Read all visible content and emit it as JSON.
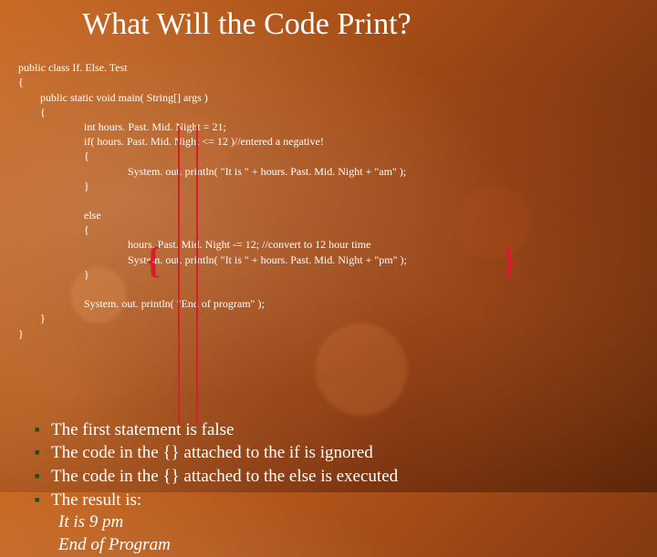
{
  "title": "What Will the Code Print?",
  "code": {
    "l1": "public class If. Else. Test",
    "l2": "{",
    "l3": "        public static void main( String[] args )",
    "l4": "        {",
    "l5": "                        int hours. Past. Mid. Night = 21;",
    "l6": "                        if( hours. Past. Mid. Night <= 12 )//entered a negative!",
    "l7": "                        {",
    "l8": "                                        System. out. println( \"It is \" + hours. Past. Mid. Night + \"am\" );",
    "l9": "                        }",
    "l10": "",
    "l11": "                        else",
    "l12": "                        {",
    "l13": "                                        hours. Past. Mid. Night -= 12; //convert to 12 hour time",
    "l14": "                                        System. out. println( \"It is \" + hours. Past. Mid. Night + \"pm\" );",
    "l15": "                        }",
    "l16": "",
    "l17": "                        System. out. println( \"End of program\" );",
    "l18": "        }",
    "l19": "}"
  },
  "bullets": {
    "b1": "The first statement is false",
    "b2": "The code in the {} attached to the if is ignored",
    "b3": "The code in the {} attached to the else is executed",
    "b4": "The result is:"
  },
  "result": {
    "r1": "It is 9 pm",
    "r2": "End of Program"
  }
}
